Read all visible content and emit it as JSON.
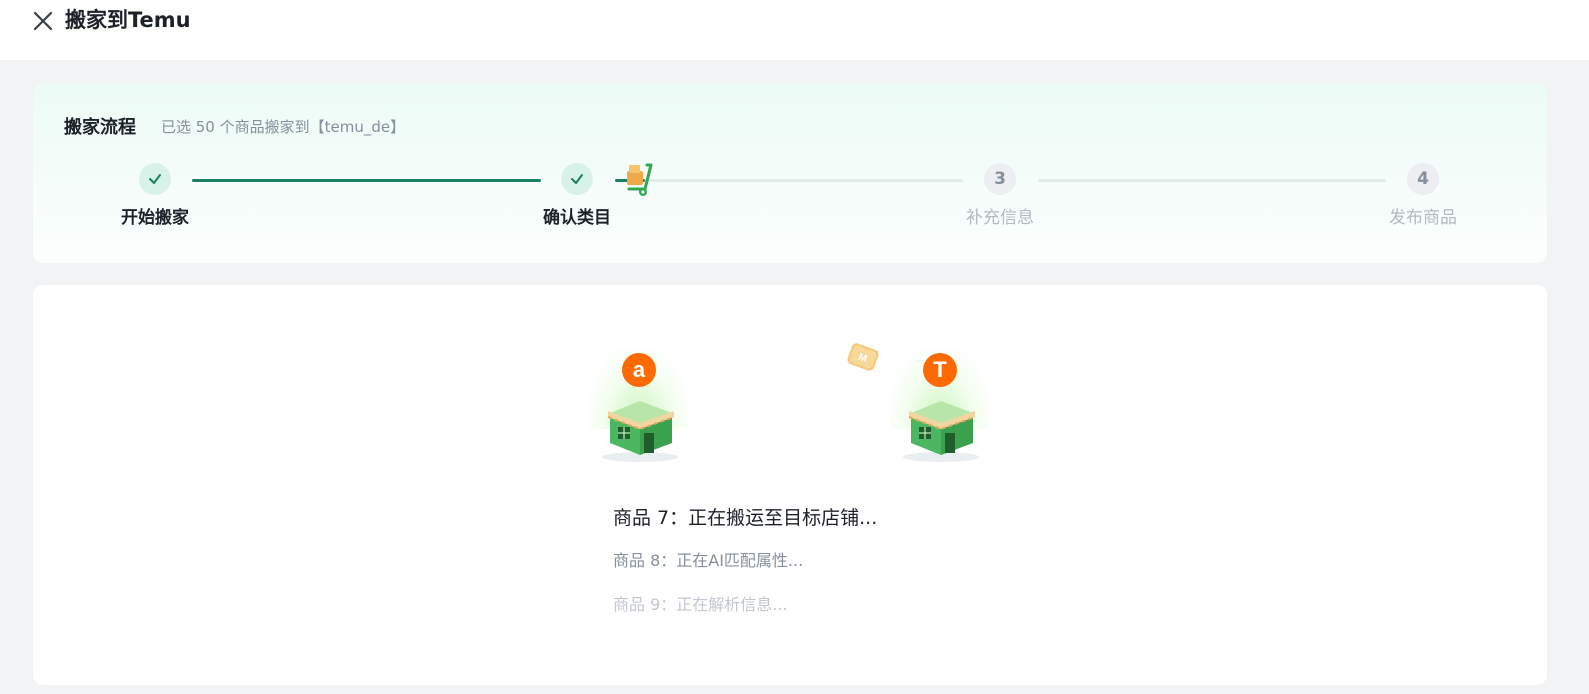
{
  "header": {
    "title": "搬家到Temu",
    "close_icon": "close-icon"
  },
  "flow": {
    "title": "搬家流程",
    "subtitle": "已选 50 个商品搬家到【temu_de】",
    "steps": [
      {
        "label": "开始搬家",
        "status": "done",
        "number": ""
      },
      {
        "label": "确认类目",
        "status": "done",
        "number": ""
      },
      {
        "label": "补充信息",
        "status": "todo",
        "number": "3"
      },
      {
        "label": "发布商品",
        "status": "todo",
        "number": "4"
      }
    ],
    "colors": {
      "accent": "#1b7f62",
      "done_bg": "#d8f2e9",
      "todo_text": "#b4b9c2"
    }
  },
  "migration": {
    "source_store": {
      "icon": "amazon-store-icon",
      "badge": "a"
    },
    "target_store": {
      "icon": "temu-store-icon",
      "badge": "T"
    },
    "progress": [
      "商品 7：正在搬运至目标店铺...",
      "商品 8：正在AI匹配属性...",
      "商品 9：正在解析信息..."
    ]
  }
}
